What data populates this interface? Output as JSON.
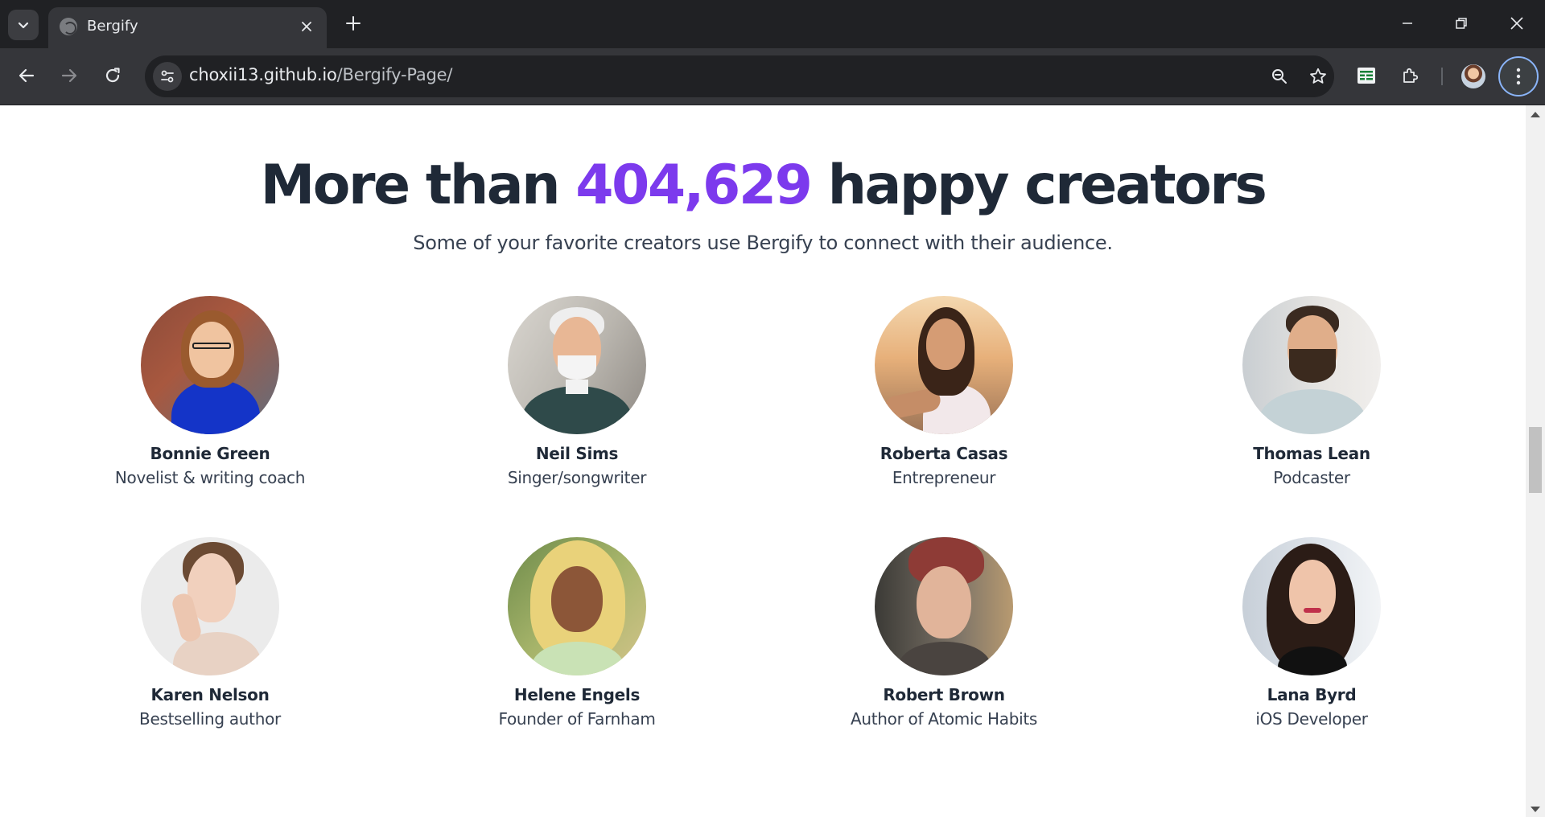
{
  "browser": {
    "tab_title": "Bergify",
    "url_host": "choxii13.github.io",
    "url_path": "/Bergify-Page/",
    "icons": [
      "tab-search-icon",
      "globe-icon",
      "close-icon",
      "plus-icon",
      "minimize-icon",
      "restore-icon",
      "window-close-icon",
      "back-icon",
      "forward-icon",
      "reload-icon",
      "site-info-icon",
      "zoom-icon",
      "star-icon",
      "sheets-extension-icon",
      "puzzle-icon",
      "profile-avatar",
      "kebab-menu-icon"
    ]
  },
  "hero": {
    "title_prefix": "More than ",
    "title_count": "404,629",
    "title_suffix": " happy creators",
    "subtitle": "Some of your favorite creators use Bergify to connect with their audience.",
    "accent_color": "#7c3aed",
    "text_color": "#1f2937"
  },
  "creators": [
    {
      "name": "Bonnie Green",
      "role": "Novelist & writing coach"
    },
    {
      "name": "Neil Sims",
      "role": "Singer/songwriter"
    },
    {
      "name": "Roberta Casas",
      "role": "Entrepreneur"
    },
    {
      "name": "Thomas Lean",
      "role": "Podcaster"
    },
    {
      "name": "Karen Nelson",
      "role": "Bestselling author"
    },
    {
      "name": "Helene Engels",
      "role": "Founder of Farnham"
    },
    {
      "name": "Robert Brown",
      "role": "Author of Atomic Habits"
    },
    {
      "name": "Lana Byrd",
      "role": "iOS Developer"
    }
  ]
}
